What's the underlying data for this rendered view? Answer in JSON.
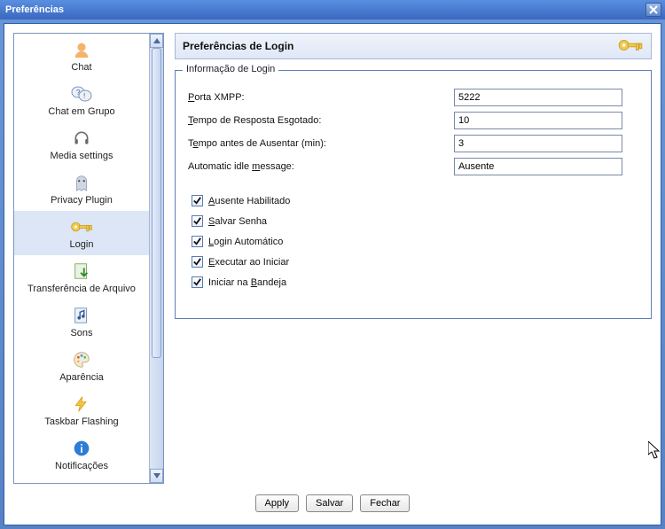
{
  "window": {
    "title": "Preferências"
  },
  "sidebar": {
    "items": [
      {
        "label": "Chat"
      },
      {
        "label": "Chat em Grupo"
      },
      {
        "label": "Media settings"
      },
      {
        "label": "Privacy Plugin"
      },
      {
        "label": "Login"
      },
      {
        "label": "Transferência de Arquivo"
      },
      {
        "label": "Sons"
      },
      {
        "label": "Aparência"
      },
      {
        "label": "Taskbar Flashing"
      },
      {
        "label": "Notificações"
      }
    ],
    "selected_index": 4
  },
  "panel": {
    "title": "Preferências de Login",
    "legend": "Informação de Login",
    "fields": {
      "port": {
        "label_pre": "",
        "label_u": "P",
        "label_post": "orta XMPP:",
        "value": "5222"
      },
      "timeout": {
        "label_pre": "",
        "label_u": "T",
        "label_post": "empo de Resposta Esgotado:",
        "value": "10"
      },
      "idle": {
        "label_pre": "T",
        "label_u": "e",
        "label_post": "mpo antes de Ausentar (min):",
        "value": "3"
      },
      "idlemsg": {
        "label_pre": "Automatic idle ",
        "label_u": "m",
        "label_post": "essage:",
        "value": "Ausente"
      }
    },
    "checks": {
      "away": {
        "pre": "",
        "u": "A",
        "post": "usente Habilitado",
        "checked": true
      },
      "save": {
        "pre": "",
        "u": "S",
        "post": "alvar Senha",
        "checked": true
      },
      "auto": {
        "pre": "",
        "u": "L",
        "post": "ogin Automático",
        "checked": true
      },
      "start": {
        "pre": "",
        "u": "E",
        "post": "xecutar ao Iniciar",
        "checked": true
      },
      "tray": {
        "pre": "Iniciar na ",
        "u": "B",
        "post": "andeja",
        "checked": true
      }
    }
  },
  "buttons": {
    "apply": "Apply",
    "save": "Salvar",
    "close": "Fechar"
  }
}
